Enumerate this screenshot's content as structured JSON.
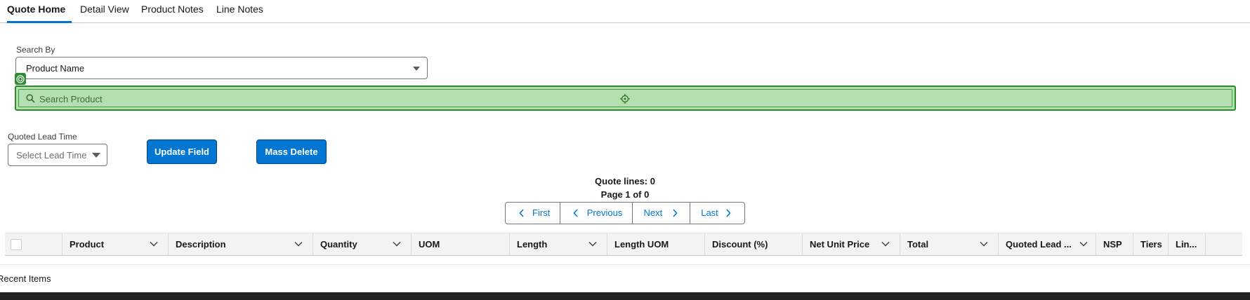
{
  "tabs": [
    {
      "label": "Quote Home",
      "active": true
    },
    {
      "label": "Detail View",
      "active": false
    },
    {
      "label": "Product Notes",
      "active": false
    },
    {
      "label": "Line Notes",
      "active": false
    }
  ],
  "search_by": {
    "label": "Search By",
    "selected": "Product Name"
  },
  "search_product": {
    "placeholder": "Search Product"
  },
  "lead_time": {
    "label": "Quoted Lead Time",
    "placeholder": "Select Lead Time"
  },
  "buttons": {
    "update_field": "Update Field",
    "mass_delete": "Mass Delete"
  },
  "summary": {
    "quote_lines": "Quote lines: 0",
    "page_of": "Page 1 of 0"
  },
  "pager": {
    "first": "First",
    "previous": "Previous",
    "next": "Next",
    "last": "Last"
  },
  "table": {
    "columns": [
      "Product",
      "Description",
      "Quantity",
      "UOM",
      "Length",
      "Length UOM",
      "Discount (%)",
      "Net Unit Price",
      "Total",
      "Quoted Lead ...",
      "NSP",
      "Tiers",
      "Lin..."
    ]
  },
  "footer": {
    "recent_items": "Recent Items"
  },
  "colors": {
    "brand": "#0176d3",
    "highlight_fill": "#b5deb1",
    "highlight_border": "#2e8b2e"
  }
}
